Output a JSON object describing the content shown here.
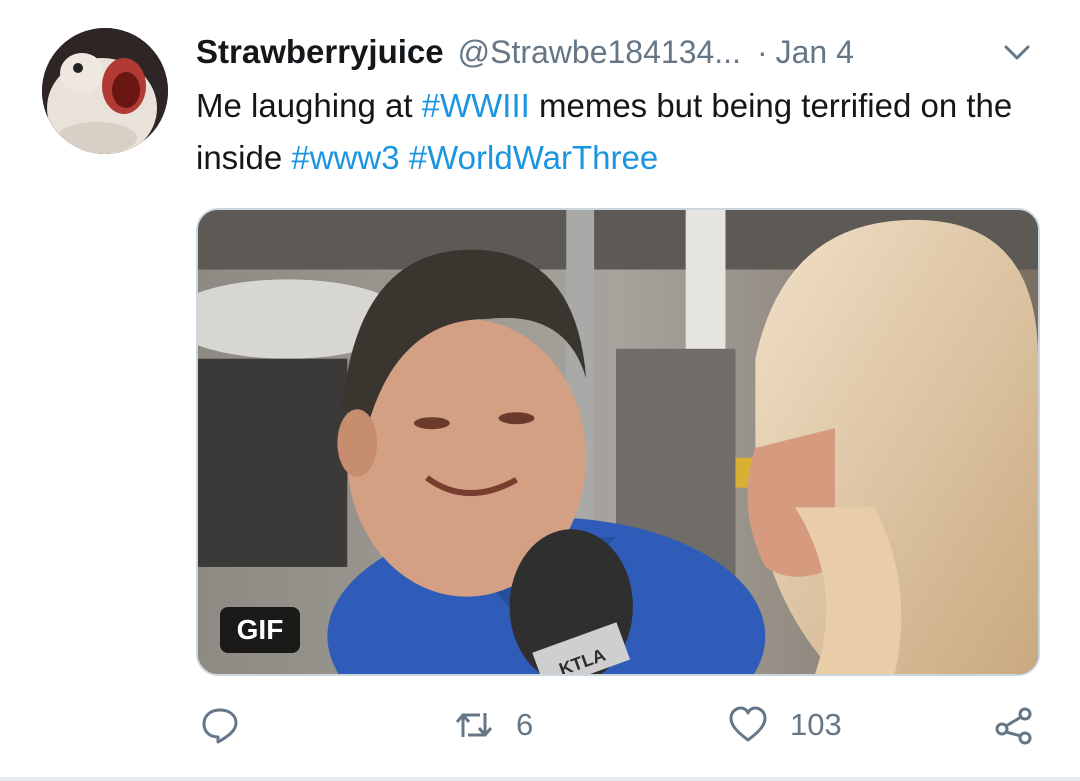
{
  "tweet": {
    "display_name": "Strawberryjuice",
    "handle": "@Strawbe184134...",
    "separator": "·",
    "date": "Jan 4",
    "text": {
      "part1": "Me laughing at ",
      "hashtag1": "#WWIII",
      "part2": " memes but being terrified on the inside ",
      "hashtag2": "#www3",
      "hashtag3": "#WorldWarThree"
    },
    "media": {
      "badge": "GIF",
      "caption_logo": "KTLA"
    }
  },
  "actions": {
    "reply_icon": "reply-icon",
    "retweet_icon": "retweet-icon",
    "retweet_count": "6",
    "like_icon": "heart-icon",
    "like_count": "103",
    "share_icon": "share-icon"
  },
  "colors": {
    "hashtag": "#1b95e0",
    "secondary_text": "#657786",
    "icon": "#657786",
    "border": "#ccd6dd"
  }
}
